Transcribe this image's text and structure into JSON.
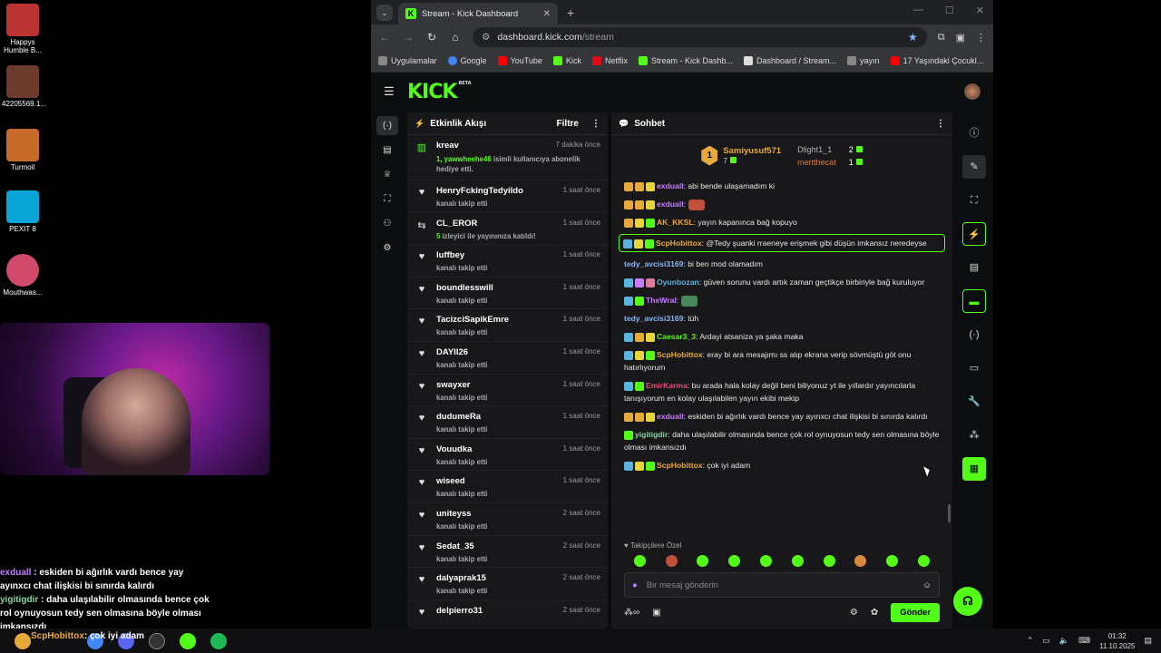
{
  "desktop_icons": [
    {
      "label": "Happys Humble B...",
      "color": "#b33"
    },
    {
      "label": "42205569.1...",
      "color": "#6b3a2a"
    },
    {
      "label": "Turmoil",
      "color": "#c76b2a"
    },
    {
      "label": "PEXIT 8",
      "color": "#0aa5d8"
    },
    {
      "label": "Mouthwas...",
      "color": "#d24a6a"
    }
  ],
  "overlay_chat": {
    "u1": "exduall",
    "m1": " : eskiden bi ağırlık vardı bence yay ayınxcı chat ilişkisi bi sınırda kalırdı",
    "u2": "yigitigdir",
    "m2": " : daha ulaşılabilir olmasında bence çok rol oynuyosun tedy sen olmasına böyle olması imkansızdı"
  },
  "taskbar": {
    "ticker_user": "ScpHobittox",
    "ticker_msg": ": çok iyi adam",
    "time": "01:32",
    "date": "11.10.2025"
  },
  "browser": {
    "tab_title": "Stream - Kick Dashboard",
    "url_host": "dashboard.kick.com",
    "url_path": "/stream",
    "bookmarks": [
      {
        "label": "Uygulamalar",
        "color": "#888"
      },
      {
        "label": "Google",
        "color": "#4285f4"
      },
      {
        "label": "YouTube",
        "color": "#ff0000"
      },
      {
        "label": "Kick",
        "color": "#53fc18"
      },
      {
        "label": "Netflix",
        "color": "#e50914"
      },
      {
        "label": "Stream - Kick Dashb...",
        "color": "#53fc18"
      },
      {
        "label": "Dashboard / Stream...",
        "color": "#ddd"
      },
      {
        "label": "yayın",
        "color": "#888"
      },
      {
        "label": "17 Yaşındaki Çocukl...",
        "color": "#ff0000"
      }
    ]
  },
  "kick": {
    "logo": "KICK",
    "logo_tag": "BETA",
    "events_panel": {
      "title": "Etkinlik Akışı",
      "filter": "Filtre",
      "items": [
        {
          "name": "kreav",
          "time": "7 dakika önce",
          "desc_hl": "1, yawwheehe46",
          "desc": " isimli kullanıcıya abonelik hediye etti.",
          "icon": "gift-icon"
        },
        {
          "name": "HenryFckingTedyildo",
          "time": "1 saat önce",
          "desc_hl": "",
          "desc": "kanalı takip etti",
          "icon": "heart-icon"
        },
        {
          "name": "CL_EROR",
          "time": "1 saat önce",
          "desc_hl": "5",
          "desc": " izleyici ile yayınınıza katıldı!",
          "icon": "raid-icon"
        },
        {
          "name": "luffbey",
          "time": "1 saat önce",
          "desc_hl": "",
          "desc": "kanalı takip etti",
          "icon": "heart-icon"
        },
        {
          "name": "boundlesswill",
          "time": "1 saat önce",
          "desc_hl": "",
          "desc": "kanalı takip etti",
          "icon": "heart-icon"
        },
        {
          "name": "TacizciSapikEmre",
          "time": "1 saat önce",
          "desc_hl": "",
          "desc": "kanalı takip etti",
          "icon": "heart-icon"
        },
        {
          "name": "DAYII26",
          "time": "1 saat önce",
          "desc_hl": "",
          "desc": "kanalı takip etti",
          "icon": "heart-icon"
        },
        {
          "name": "swayxer",
          "time": "1 saat önce",
          "desc_hl": "",
          "desc": "kanalı takip etti",
          "icon": "heart-icon"
        },
        {
          "name": "dudumeRa",
          "time": "1 saat önce",
          "desc_hl": "",
          "desc": "kanalı takip etti",
          "icon": "heart-icon"
        },
        {
          "name": "Vouudka",
          "time": "1 saat önce",
          "desc_hl": "",
          "desc": "kanalı takip etti",
          "icon": "heart-icon"
        },
        {
          "name": "wiseed",
          "time": "1 saat önce",
          "desc_hl": "",
          "desc": "kanalı takip etti",
          "icon": "heart-icon"
        },
        {
          "name": "uniteyss",
          "time": "2 saat önce",
          "desc_hl": "",
          "desc": "kanalı takip etti",
          "icon": "heart-icon"
        },
        {
          "name": "Sedat_35",
          "time": "2 saat önce",
          "desc_hl": "",
          "desc": "kanalı takip etti",
          "icon": "heart-icon"
        },
        {
          "name": "dalyaprak15",
          "time": "2 saat önce",
          "desc_hl": "",
          "desc": "kanalı takip etti",
          "icon": "heart-icon"
        },
        {
          "name": "delpierro31",
          "time": "2 saat önce",
          "desc_hl": "",
          "desc": "",
          "icon": "heart-icon"
        }
      ]
    },
    "chat_panel": {
      "title": "Sohbet",
      "leaderboard": {
        "first_name": "Samiyusuf571",
        "first_count": "7",
        "second_name": "Dlight1_1",
        "second_count": "2",
        "third_name": "mertthecat",
        "third_count": "1"
      },
      "messages": [
        {
          "user": "exduall",
          "color": "#c77dff",
          "text": ": abi bende ulaşamadım ki",
          "badges": [
            "#e8a93c",
            "#e8a93c",
            "#e8d43c"
          ]
        },
        {
          "user": "exduall",
          "color": "#c77dff",
          "text": ":",
          "badges": [
            "#e8a93c",
            "#e8a93c",
            "#e8d43c"
          ],
          "emote": "#c0503a"
        },
        {
          "user": "AK_KKSL",
          "color": "#e8a93c",
          "text": ": yayın kapanınca bağ kopuyo",
          "badges": [
            "#e8a93c",
            "#e8d43c",
            "#53fc18"
          ]
        },
        {
          "user": "ScpHobittox",
          "color": "#e8a93c",
          "text": ": @Tedy şuanki rraeneye erişmek gibi düşün imkansız neredeyse",
          "badges": [
            "#5ab4e0",
            "#e8d43c",
            "#53fc18"
          ],
          "highlight": true
        },
        {
          "user": "tedy_avcisi3169",
          "color": "#8ab4f8",
          "text": ": bi ben mod olamadım",
          "badges": []
        },
        {
          "user": "Oyunbozan",
          "color": "#5ab4e0",
          "text": ": güven sorunu vardı artık zaman geçtikçe birbiriyle bağ kuruluyor",
          "badges": [
            "#5ab4e0",
            "#c77dff",
            "#e07a9a"
          ]
        },
        {
          "user": "TheWral",
          "color": "#c77dff",
          "text": ":",
          "badges": [
            "#5ab4e0",
            "#53fc18"
          ],
          "emote": "#4a8a5a"
        },
        {
          "user": "tedy_avcisi3169",
          "color": "#8ab4f8",
          "text": ": tüh",
          "badges": []
        },
        {
          "user": "Caesar3_3",
          "color": "#53fc18",
          "text": ": Ardayi atsaniza ya şaka maka",
          "badges": [
            "#5ab4e0",
            "#e8a93c",
            "#e8d43c"
          ]
        },
        {
          "user": "ScpHobittox",
          "color": "#e8a93c",
          "text": ": eray bi ara mesajımı ss alıp ekrana verip sövmüştü göt onu hatırlıyorum",
          "badges": [
            "#5ab4e0",
            "#e8d43c",
            "#53fc18"
          ]
        },
        {
          "user": "EmirKarma",
          "color": "#e0507a",
          "text": ": bu arada hala kolay değil beni biliyonuz yt ile yıllardır yayıncılarla tanışıyorum en kolay ulaşılabilen yayın ekibi mekip",
          "badges": [
            "#5ab4e0",
            "#53fc18"
          ]
        },
        {
          "user": "exduall",
          "color": "#c77dff",
          "text": ": eskiden bi ağırlık vardı bence yay ayınxcı chat ilişkisi bi sınırda kalırdı",
          "badges": [
            "#e8a93c",
            "#e8a93c",
            "#e8d43c"
          ]
        },
        {
          "user": "yigitigdir",
          "color": "#8bd5a0",
          "text": ": daha ulaşılabilir olmasında bence çok rol oynuyosun tedy sen olmasına böyle olması imkansızdı",
          "badges": [
            "#53fc18"
          ]
        },
        {
          "user": "ScpHobittox",
          "color": "#e8a93c",
          "text": ": çok iyi adam",
          "badges": [
            "#5ab4e0",
            "#e8d43c",
            "#53fc18"
          ]
        }
      ],
      "followers_only": "Takipçilere Özel",
      "input_placeholder": "Bir mesaj gönderin",
      "send_label": "Gönder"
    }
  }
}
